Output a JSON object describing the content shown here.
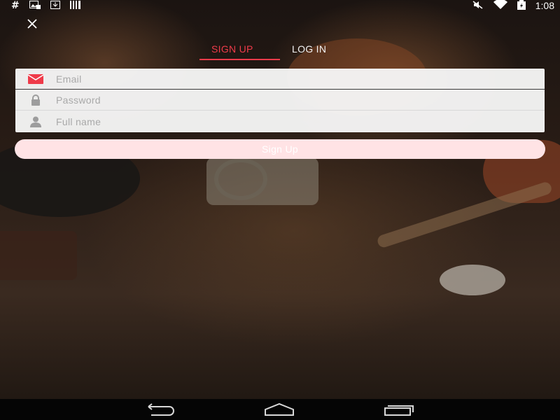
{
  "status_bar": {
    "left_icons": [
      "hash-icon",
      "image-download-icon",
      "download-icon",
      "barcode-icon"
    ],
    "right_icons": [
      "mute-icon",
      "wifi-icon",
      "battery-icon"
    ],
    "time": "1:08"
  },
  "close_icon": "close-icon",
  "tabs": [
    {
      "label": "SIGN UP",
      "active": true
    },
    {
      "label": "LOG IN",
      "active": false
    }
  ],
  "form": {
    "email": {
      "placeholder": "Email",
      "value": "",
      "icon": "mail-icon"
    },
    "password": {
      "placeholder": "Password",
      "value": "",
      "icon": "lock-icon"
    },
    "full_name": {
      "placeholder": "Full name",
      "value": "",
      "icon": "person-icon"
    }
  },
  "submit": {
    "label": "Sign Up"
  },
  "colors": {
    "accent": "#ef3b4a",
    "button_bg": "#ffe3e5",
    "form_bg": "#f6f6f6"
  },
  "nav_bar": {
    "icons": [
      "back-icon",
      "home-icon",
      "recents-icon"
    ]
  }
}
